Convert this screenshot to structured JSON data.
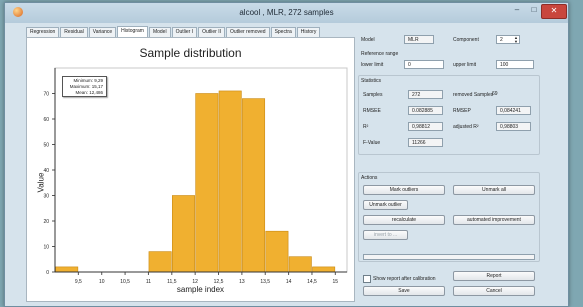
{
  "window": {
    "title": "alcool , MLR, 272 samples",
    "min": "–",
    "max": "□",
    "close": "✕"
  },
  "tabs": [
    {
      "label": "Regression"
    },
    {
      "label": "Residual"
    },
    {
      "label": "Variance"
    },
    {
      "label": "Histogram",
      "active": true
    },
    {
      "label": "Model"
    },
    {
      "label": "Outlier I"
    },
    {
      "label": "Outlier II"
    },
    {
      "label": "Outlier removed"
    },
    {
      "label": "Spectra"
    },
    {
      "label": "History"
    }
  ],
  "chart_data": {
    "type": "bar",
    "title": "Sample distribution",
    "xlabel": "sample index",
    "ylabel": "Value",
    "bins": [
      9.25,
      9.75,
      10.25,
      10.75,
      11.25,
      11.75,
      12.25,
      12.75,
      13.25,
      13.75,
      14.25,
      14.75
    ],
    "bin_width": 0.5,
    "values": [
      2,
      0,
      0,
      0,
      8,
      30,
      70,
      71,
      68,
      16,
      6,
      2
    ],
    "xlim": [
      9.0,
      15.25
    ],
    "ylim": [
      0,
      80
    ],
    "x_ticks": [
      "9,5",
      "10",
      "10,5",
      "11",
      "11,5",
      "12",
      "12,5",
      "13",
      "13,5",
      "14",
      "14,5",
      "15"
    ],
    "x_tick_values": [
      9.5,
      10,
      10.5,
      11,
      11.5,
      12,
      12.5,
      13,
      13.5,
      14,
      14.5,
      15
    ],
    "y_ticks": [
      0,
      10,
      20,
      30,
      40,
      50,
      60,
      70
    ],
    "bar_color": "#f0b030",
    "bar_edge": "#c98a14",
    "stats": {
      "min": "Minimum: 9,29",
      "max": "Maximum: 15,17",
      "mean": "Mean: 12,486"
    }
  },
  "panel": {
    "model_label": "Model",
    "model_value": "MLR",
    "component_label": "Component",
    "component_value": "2",
    "ref_range_label": "Reference range",
    "lower_label": "lower limit",
    "lower_value": "0",
    "upper_label": "upper limit",
    "upper_value": "100",
    "statistics_label": "Statistics",
    "samples_label": "Samples",
    "samples_value": "272",
    "removed_label": "removed Samples",
    "removed_value": "69",
    "rmsee_label": "RMSEE",
    "rmsee_value": "0.082885",
    "rmsep_label": "RMSEP",
    "rmsep_value": "0,084241",
    "r2_label": "R²",
    "r2_value": "0,98812",
    "adj_r2_label": "adjusted R²",
    "adj_r2_value": "0,98803",
    "fvalue_label": "F-Value",
    "fvalue_value": "11266",
    "actions_label": "Actions",
    "mark_outliers": "Mark outliers",
    "unmark_all": "Unmark all",
    "unmark_outlier": "Unmark outlier",
    "recalculate": "recalculate",
    "automated": "automated improvement",
    "invert": "invert to ...",
    "show_report_label": "Show report after calibration",
    "report": "Report",
    "save": "Save",
    "cancel": "Cancel"
  }
}
